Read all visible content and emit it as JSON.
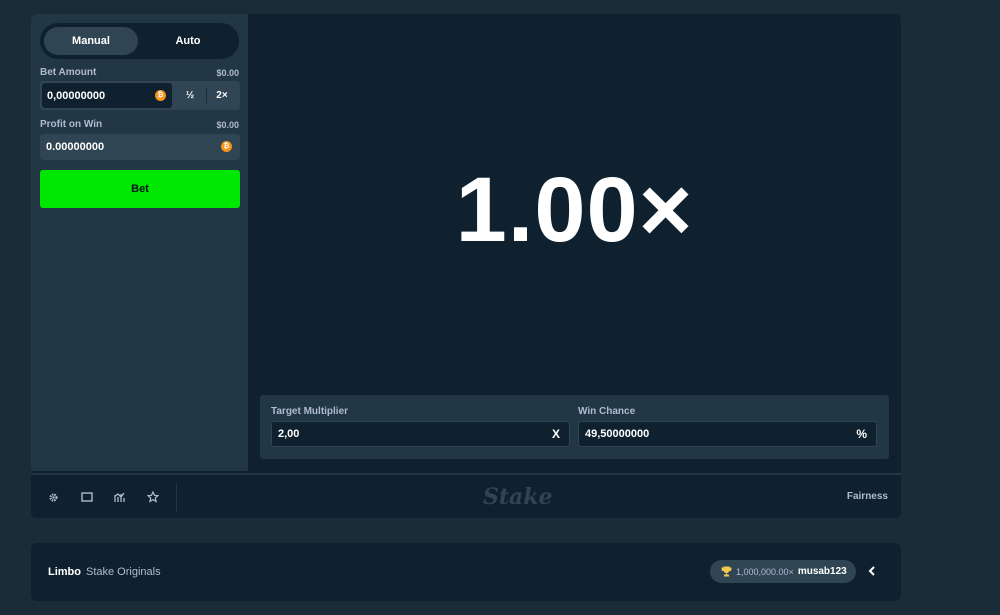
{
  "mode": {
    "manual_label": "Manual",
    "auto_label": "Auto"
  },
  "bet_amount": {
    "label": "Bet Amount",
    "usd": "$0.00",
    "value": "0,00000000",
    "half_label": "½",
    "double_label": "2×",
    "currency_icon": "bitcoin-icon"
  },
  "profit": {
    "label": "Profit on Win",
    "usd": "$0.00",
    "value": "0.00000000",
    "currency_icon": "bitcoin-icon"
  },
  "bet_button_label": "Bet",
  "result": {
    "multiplier": "1.00×"
  },
  "target": {
    "label": "Target Multiplier",
    "value": "2,00",
    "suffix": "X"
  },
  "win_chance": {
    "label": "Win Chance",
    "value": "49,50000000",
    "suffix": "%"
  },
  "footer": {
    "icons": [
      "gear-icon",
      "theatre-mode-icon",
      "stats-icon",
      "favourite-star-icon"
    ],
    "logo": "Stake",
    "fairness_label": "Fairness"
  },
  "info": {
    "game_name": "Limbo",
    "provider": "Stake Originals",
    "record_value": "1,000,000.00×",
    "record_user": "musab123",
    "record_icon": "trophy-icon"
  },
  "colors": {
    "page_bg": "#1a2c38",
    "panel_bg": "#213743",
    "game_bg": "#0f212e",
    "bet_button": "#00e701",
    "coin": "#f7931a",
    "trophy": "#f2c94c"
  }
}
